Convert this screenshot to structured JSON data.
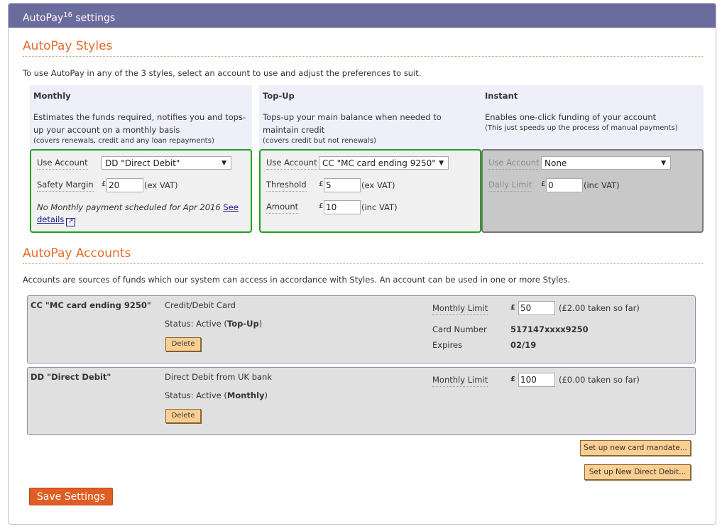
{
  "window": {
    "title": "AutoPay",
    "title_sup": "16",
    "title_suffix": " settings"
  },
  "styles_section": {
    "heading": "AutoPay Styles",
    "intro": "To use AutoPay in any of the 3 styles, select an account to use and adjust the preferences to suit.",
    "monthly": {
      "name": "Monthly",
      "desc": "Estimates the funds required, notifies you and tops-up your account on a monthly basis",
      "note": "(covers renewals, credit and any loan repayments)",
      "use_account_label": "Use Account",
      "use_account_value": "DD \"Direct Debit\"",
      "safety_margin_label": "Safety Margin",
      "safety_margin_currency": "£",
      "safety_margin_value": "20",
      "safety_margin_unit": "(ex VAT)",
      "schedule_note": "No Monthly payment scheduled for Apr 2016",
      "see_details_link": "See details"
    },
    "topup": {
      "name": "Top-Up",
      "desc": "Tops-up your main balance when needed to maintain credit",
      "note": "(covers credit but not renewals)",
      "use_account_label": "Use Account",
      "use_account_value": "CC \"MC card ending 9250\"",
      "threshold_label": "Threshold",
      "threshold_currency": "£",
      "threshold_value": "5",
      "threshold_unit": "(ex VAT)",
      "amount_label": "Amount",
      "amount_currency": "£",
      "amount_value": "10",
      "amount_unit": "(inc VAT)"
    },
    "instant": {
      "name": "Instant",
      "desc": "Enables one-click funding of your account",
      "note": "(This just speeds up the process of manual payments)",
      "use_account_label": "Use Account",
      "use_account_value": "None",
      "daily_limit_label": "Daily Limit",
      "daily_limit_currency": "£",
      "daily_limit_value": "0",
      "daily_limit_unit": "(inc VAT)"
    }
  },
  "accounts_section": {
    "heading": "AutoPay Accounts",
    "intro": "Accounts are sources of funds which our system can access in accordance with Styles. An account can be used in one or more Styles.",
    "accounts": [
      {
        "name": "CC \"MC card ending 9250\"",
        "type": "Credit/Debit Card",
        "status_prefix": "Status: Active (",
        "status_style": "Top-Up",
        "status_suffix": ")",
        "delete_label": "Delete",
        "monthly_limit_label": "Monthly Limit",
        "currency": "£",
        "monthly_limit_value": "50",
        "taken_so_far": "(£2.00 taken so far)",
        "card_number_label": "Card Number",
        "card_number_value": "517147xxxx9250",
        "expires_label": "Expires",
        "expires_value": "02/19"
      },
      {
        "name": "DD \"Direct Debit\"",
        "type": "Direct Debit from UK bank",
        "status_prefix": "Status: Active (",
        "status_style": "Monthly",
        "status_suffix": ")",
        "delete_label": "Delete",
        "monthly_limit_label": "Monthly Limit",
        "currency": "£",
        "monthly_limit_value": "100",
        "taken_so_far": "(£0.00 taken so far)"
      }
    ],
    "new_card_button": "Set up new card mandate...",
    "new_dd_button": "Set up New Direct Debit..."
  },
  "save_button": "Save Settings",
  "icons": {
    "dropdown": "chevron-down-icon",
    "external_link": "external-link-icon"
  },
  "colors": {
    "titlebar": "#6b6b9d",
    "heading": "#e56a2c",
    "active_border": "#21a021",
    "save_button": "#e05e24",
    "button_bg": "#fbcf92"
  }
}
